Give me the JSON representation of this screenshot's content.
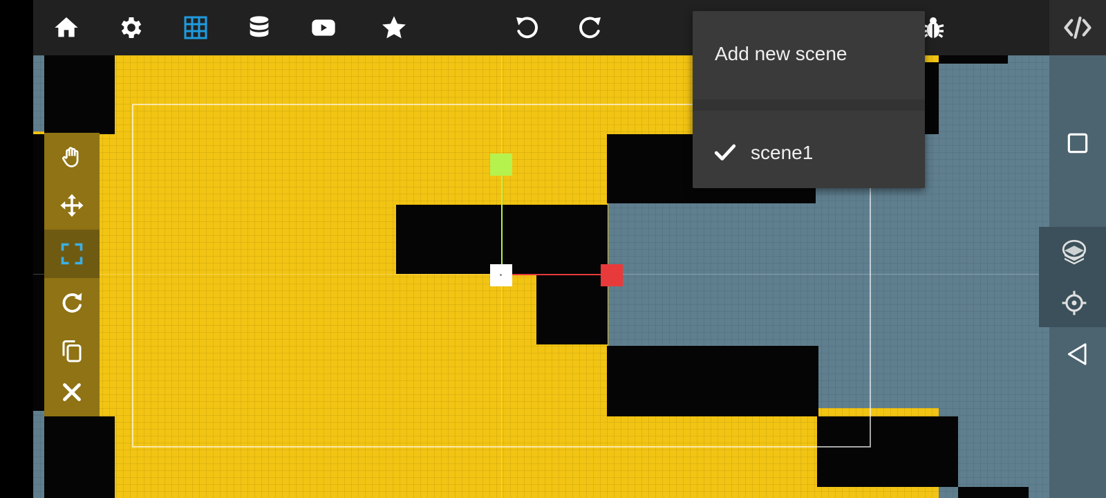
{
  "toolbar": {
    "buttons": [
      {
        "icon": "home-icon"
      },
      {
        "icon": "gear-icon"
      },
      {
        "icon": "grid-icon",
        "active": true,
        "color": "#1e9be0"
      },
      {
        "icon": "database-icon"
      },
      {
        "icon": "youtube-icon"
      },
      {
        "icon": "star-icon"
      },
      {
        "icon": "undo-icon"
      },
      {
        "icon": "redo-icon"
      },
      {
        "icon": "bug-icon"
      },
      {
        "icon": "code-icon"
      }
    ]
  },
  "left_tools": [
    {
      "icon": "hand-icon"
    },
    {
      "icon": "move-icon"
    },
    {
      "icon": "scale-icon",
      "active": true,
      "color": "#3bb0e6"
    },
    {
      "icon": "rotate-icon"
    },
    {
      "icon": "copy-icon"
    },
    {
      "icon": "close-icon"
    }
  ],
  "right_panel": [
    {
      "icon": "square-icon"
    },
    {
      "icon": "layers-icon"
    },
    {
      "icon": "crosshair-icon"
    },
    {
      "icon": "back-triangle-icon"
    }
  ],
  "scene_menu": {
    "add_label": "Add new scene",
    "scenes": [
      {
        "name": "scene1",
        "checked": true
      }
    ]
  },
  "colors": {
    "canvas_yellow": "#f2c413",
    "sky_blue": "#5f7f8f",
    "gizmo_y": "#b6f24d",
    "gizmo_x": "#e83a3a",
    "accent_blue": "#1e9be0"
  }
}
